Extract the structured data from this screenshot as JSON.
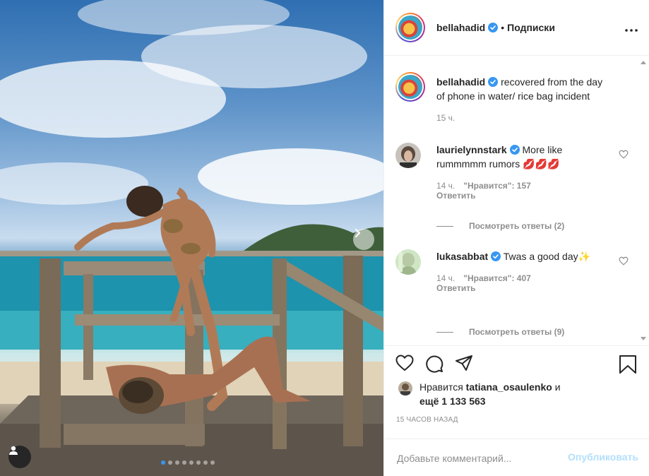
{
  "post": {
    "username": "bellahadid",
    "follow_separator": "•",
    "follow_label": "Подписки",
    "more_icon": "more-horizontal-icon",
    "caption": {
      "username": "bellahadid",
      "text": "recovered from the day of phone in water/ rice bag incident",
      "time": "15 ч."
    },
    "carousel": {
      "dots": 8,
      "active": 0
    }
  },
  "comments": [
    {
      "username": "laurielynnstark",
      "text": "More like rummmmm rumors",
      "emoji": "💋💋💋",
      "time": "14 ч.",
      "likes": "\"Нравится\": 157",
      "reply_label": "Ответить",
      "view_replies": "Посмотреть ответы (2)"
    },
    {
      "username": "lukasabbat",
      "text": "Twas a good day",
      "emoji": "✨",
      "time": "14 ч.",
      "likes": "\"Нравится\": 407",
      "reply_label": "Ответить",
      "view_replies": "Посмотреть ответы (9)"
    }
  ],
  "likes": {
    "prefix": "Нравится",
    "user": "tatiana_osaulenko",
    "mid": "и",
    "more": "ещё 1 133 563"
  },
  "time_ago": "15 ЧАСОВ НАЗАД",
  "comment_box": {
    "placeholder": "Добавьте комментарий...",
    "post_label": "Опубликовать"
  },
  "colors": {
    "verified": "#3897f0",
    "post_button_disabled": "#b2dffc",
    "secondary_text": "#8e8e8e",
    "primary_text": "#262626"
  }
}
